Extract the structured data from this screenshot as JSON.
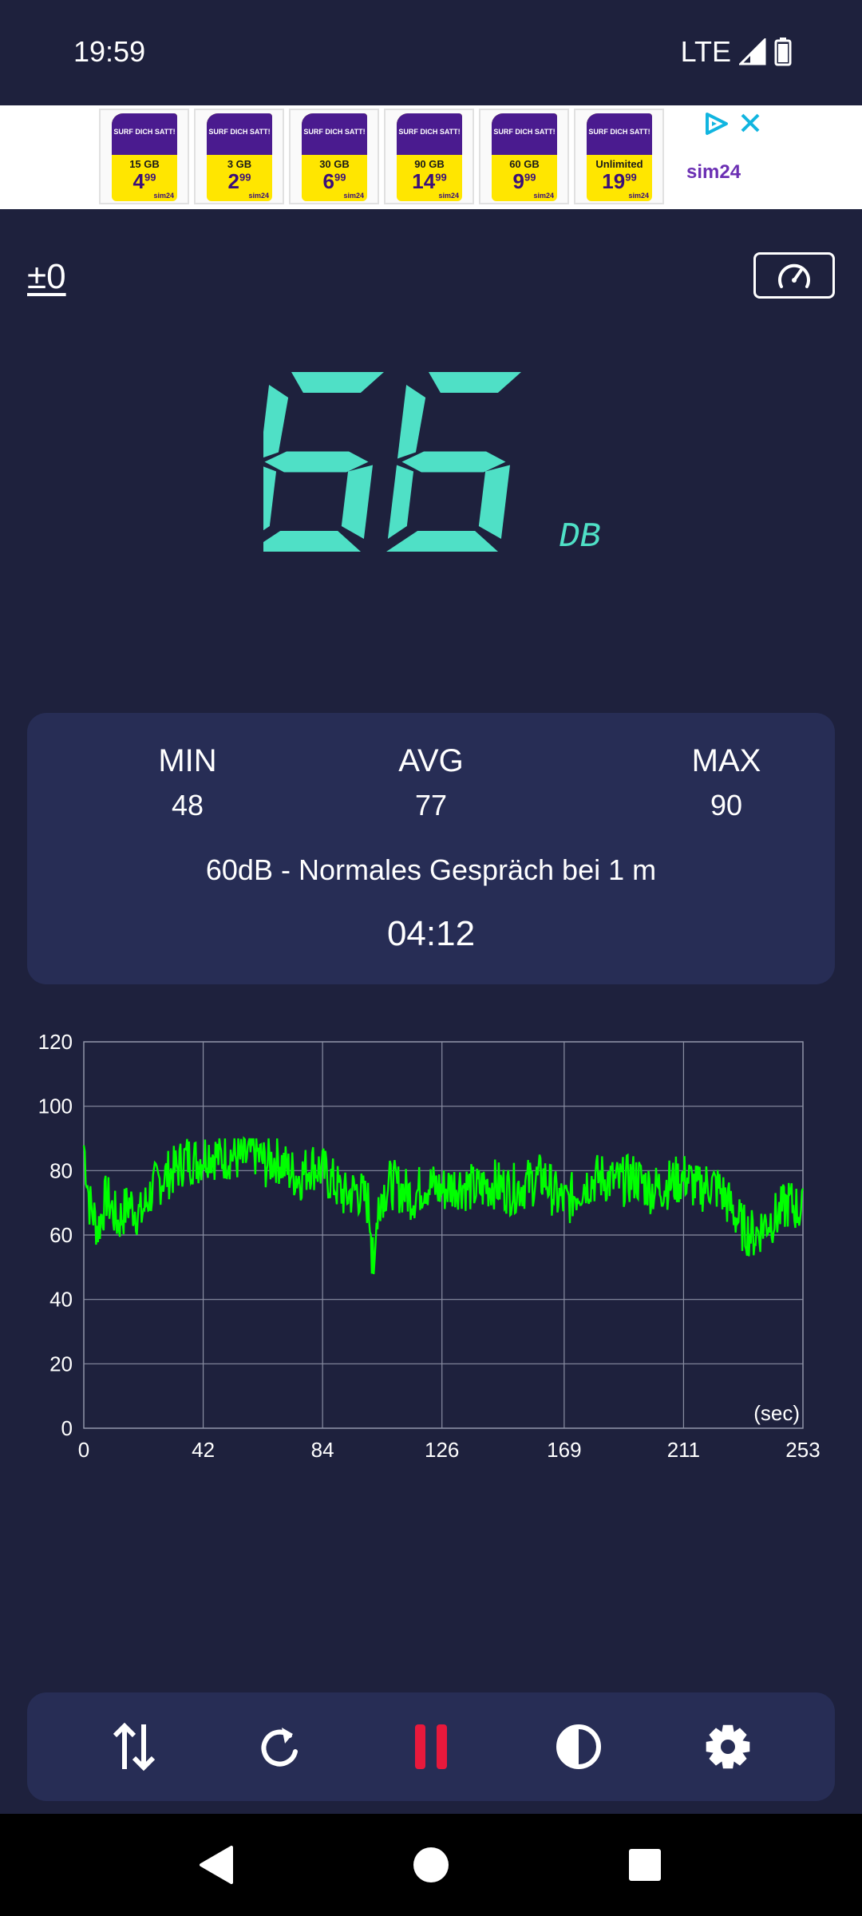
{
  "status_bar": {
    "time": "19:59",
    "network": "LTE"
  },
  "ad": {
    "cards": [
      {
        "headline": "SURF DICH SATT!",
        "data": "15 GB",
        "price": "4",
        "cents": "99",
        "brand": "sim24"
      },
      {
        "headline": "SURF DICH SATT!",
        "data": "3 GB",
        "price": "2",
        "cents": "99",
        "brand": "sim24"
      },
      {
        "headline": "SURF DICH SATT!",
        "data": "30 GB",
        "price": "6",
        "cents": "99",
        "brand": "sim24"
      },
      {
        "headline": "SURF DICH SATT!",
        "data": "90 GB",
        "price": "14",
        "cents": "99",
        "brand": "sim24"
      },
      {
        "headline": "SURF DICH SATT!",
        "data": "60 GB",
        "price": "9",
        "cents": "99",
        "brand": "sim24"
      },
      {
        "headline": "SURF DICH SATT!",
        "data": "Unlimited",
        "price": "19",
        "cents": "99",
        "brand": "sim24"
      }
    ],
    "logo": "sim24"
  },
  "meter": {
    "calibration": "±0",
    "reading": "66",
    "unit": "DB",
    "accent_color": "#4fe0c6"
  },
  "stats": {
    "min_label": "MIN",
    "min_value": "48",
    "avg_label": "AVG",
    "avg_value": "77",
    "max_label": "MAX",
    "max_value": "90",
    "description": "60dB - Normales Gespräch bei 1 m",
    "elapsed": "04:12"
  },
  "chart_data": {
    "type": "line",
    "ylim": [
      0,
      120
    ],
    "xlim": [
      0,
      253
    ],
    "y_ticks": [
      "0",
      "20",
      "40",
      "60",
      "80",
      "100",
      "120"
    ],
    "x_ticks": [
      "0",
      "42",
      "84",
      "126",
      "169",
      "211",
      "253"
    ],
    "x_unit_label": "(sec)",
    "line_color": "#00ff00",
    "grid": true,
    "anchors": [
      [
        0,
        88
      ],
      [
        2,
        70
      ],
      [
        5,
        62
      ],
      [
        8,
        72
      ],
      [
        12,
        64
      ],
      [
        16,
        70
      ],
      [
        20,
        66
      ],
      [
        24,
        74
      ],
      [
        28,
        78
      ],
      [
        32,
        80
      ],
      [
        36,
        84
      ],
      [
        40,
        83
      ],
      [
        44,
        86
      ],
      [
        48,
        84
      ],
      [
        52,
        85
      ],
      [
        56,
        83
      ],
      [
        60,
        86
      ],
      [
        64,
        82
      ],
      [
        68,
        84
      ],
      [
        72,
        80
      ],
      [
        76,
        78
      ],
      [
        80,
        82
      ],
      [
        84,
        80
      ],
      [
        88,
        76
      ],
      [
        92,
        72
      ],
      [
        96,
        74
      ],
      [
        100,
        70
      ],
      [
        102,
        55
      ],
      [
        104,
        72
      ],
      [
        108,
        76
      ],
      [
        112,
        74
      ],
      [
        116,
        72
      ],
      [
        120,
        76
      ],
      [
        126,
        74
      ],
      [
        132,
        76
      ],
      [
        138,
        74
      ],
      [
        144,
        76
      ],
      [
        150,
        74
      ],
      [
        156,
        76
      ],
      [
        162,
        78
      ],
      [
        166,
        72
      ],
      [
        170,
        70
      ],
      [
        176,
        76
      ],
      [
        182,
        78
      ],
      [
        188,
        76
      ],
      [
        194,
        78
      ],
      [
        200,
        74
      ],
      [
        206,
        76
      ],
      [
        212,
        78
      ],
      [
        216,
        74
      ],
      [
        220,
        76
      ],
      [
        224,
        74
      ],
      [
        228,
        68
      ],
      [
        232,
        62
      ],
      [
        236,
        60
      ],
      [
        240,
        64
      ],
      [
        244,
        66
      ],
      [
        248,
        70
      ],
      [
        253,
        67
      ]
    ],
    "samples": 253
  },
  "toolbar": {
    "sort_icon": "swap-vertical-icon",
    "reset_icon": "refresh-icon",
    "pause_icon": "pause-icon",
    "theme_icon": "contrast-icon",
    "settings_icon": "gear-icon",
    "pause_color": "#e8193c"
  }
}
